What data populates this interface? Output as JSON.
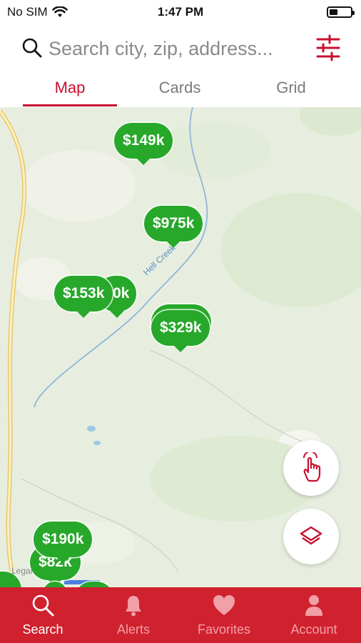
{
  "status_bar": {
    "carrier": "No SIM",
    "time": "1:47 PM",
    "battery_level": 0.35
  },
  "search": {
    "placeholder": "Search city, zip, address..."
  },
  "tabs": [
    {
      "label": "Map",
      "active": true
    },
    {
      "label": "Cards"
    },
    {
      "label": "Grid"
    }
  ],
  "map": {
    "river_label": "Hell Creek",
    "legal_label": "Legal",
    "pins": [
      {
        "price": "$149k"
      },
      {
        "price": "$975k"
      },
      {
        "price": "$153k"
      },
      {
        "price": "0k"
      },
      {
        "price": "$329k"
      },
      {
        "price": "$190k"
      },
      {
        "price": "$82k"
      }
    ]
  },
  "bottom_nav": [
    {
      "label": "Search",
      "icon": "search-icon",
      "active": true
    },
    {
      "label": "Alerts",
      "icon": "bell-icon"
    },
    {
      "label": "Favorites",
      "icon": "heart-icon"
    },
    {
      "label": "Account",
      "icon": "person-icon"
    }
  ],
  "colors": {
    "accent": "#c8102e",
    "nav_bar": "#d0212f",
    "pin": "#27a82a",
    "map_bg": "#e7eedf"
  }
}
